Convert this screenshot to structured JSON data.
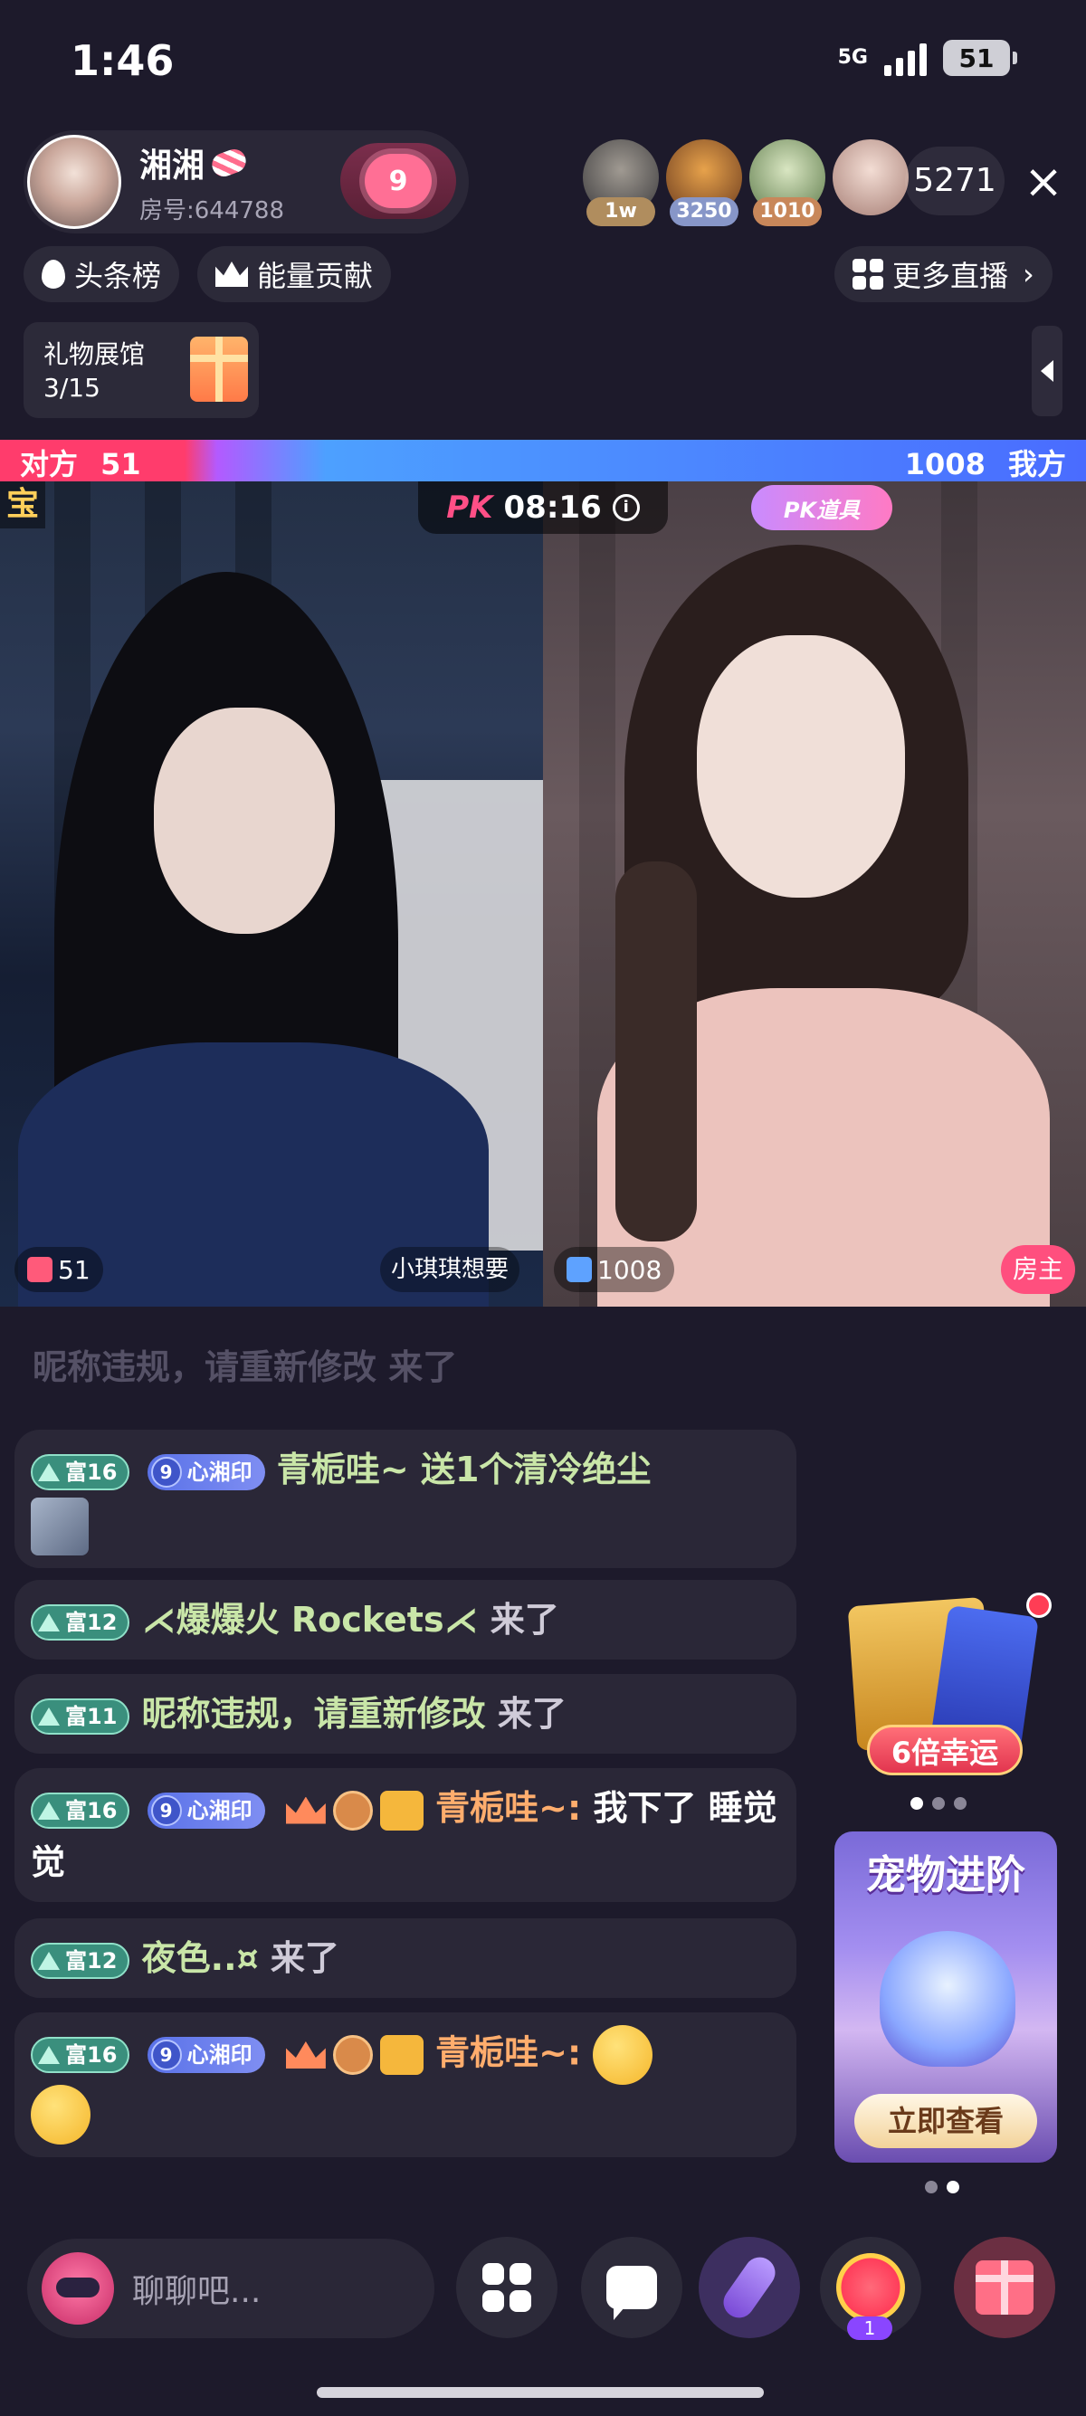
{
  "status_bar": {
    "time": "1:46",
    "network": "5G",
    "battery": "51"
  },
  "host": {
    "name": "湘湘",
    "room_number": "房号:644788",
    "heart_level": "9"
  },
  "viewers": {
    "badges": [
      "1w",
      "3250",
      "1010"
    ],
    "count": "5271",
    "close_icon": "×"
  },
  "tabs": {
    "toplist": "头条榜",
    "energy": "能量贡献",
    "more_live": "更多直播"
  },
  "gift_gallery": {
    "title": "礼物展馆",
    "progress": "3/15"
  },
  "pk": {
    "left_label": "对方",
    "left_score": "51",
    "right_label": "我方",
    "right_score": "1008",
    "timer": "08:16",
    "logo": "PK",
    "tool_label": "PK道具",
    "corner_char": "宝",
    "opponent_name": "小琪琪想要",
    "host_tag": "房主"
  },
  "chat": {
    "faded_text": "昵称违规，请重新修改 来了",
    "messages": [
      {
        "level": "富16",
        "seal": "心湘印",
        "seal_num": "9",
        "nick": "青栀哇~",
        "text": " 送1个清冷绝尘"
      },
      {
        "level": "富12",
        "nick": "⋌爆爆火 Rockets⋌",
        "text": " 来了"
      },
      {
        "level": "富11",
        "nick": "昵称违规，请重新修改",
        "text": " 来了"
      },
      {
        "level": "富16",
        "seal": "心湘印",
        "seal_num": "9",
        "nick": "青栀哇~:",
        "text": " 我下了 睡觉觉"
      },
      {
        "level": "富12",
        "nick": "夜色..¤",
        "text": " 来了"
      },
      {
        "level": "富16",
        "seal": "心湘印",
        "seal_num": "9",
        "nick": "青栀哇~:",
        "text": ""
      }
    ]
  },
  "promos": {
    "lucky_label": "6倍幸运",
    "pet_title": "宠物进阶",
    "pet_button": "立即查看"
  },
  "bottom_bar": {
    "input_placeholder": "聊聊吧...",
    "fan_badge": "1"
  },
  "colors": {
    "background": "#1d1a2b",
    "pk_red": "#ff3c6c",
    "pk_blue": "#4a6cff",
    "level_badge": "#3a8f7d",
    "nick_orange": "#ffad6d",
    "host_tag": "#ff4f7e"
  }
}
